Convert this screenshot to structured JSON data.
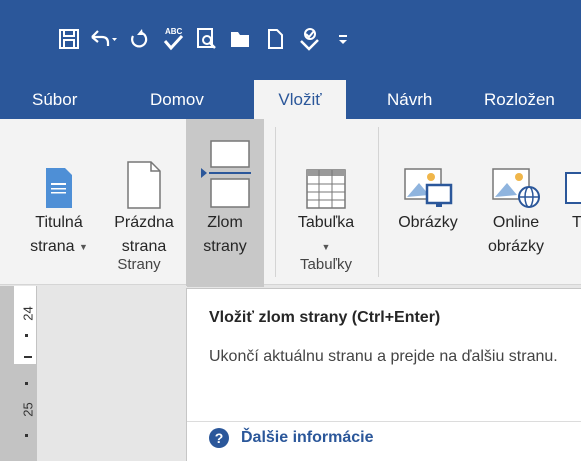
{
  "colors": {
    "brand": "#2b579a",
    "ribbon": "#f3f3f3",
    "hover": "#c8c8c8"
  },
  "qat": {
    "icons": [
      "save-icon",
      "undo-icon",
      "redo-icon",
      "spelling-icon",
      "print-preview-icon",
      "open-folder-icon",
      "new-document-icon",
      "touch-mode-icon",
      "customize-qat-icon"
    ]
  },
  "tabs": [
    {
      "label": "Súbor"
    },
    {
      "label": "Domov"
    },
    {
      "label": "Vložiť",
      "active": true
    },
    {
      "label": "Návrh"
    },
    {
      "label": "Rozložen"
    }
  ],
  "ribbon": {
    "groups": [
      {
        "label": "Strany"
      },
      {
        "label": "Tabuľky"
      }
    ],
    "buttons": {
      "cover_page": {
        "line1": "Titulná",
        "line2": "strana"
      },
      "blank_page": {
        "line1": "Prázdna",
        "line2": "strana"
      },
      "page_break": {
        "line1": "Zlom",
        "line2": "strany"
      },
      "table": {
        "line1": "Tabuľka"
      },
      "pictures": {
        "line1": "Obrázky"
      },
      "online_pictures": {
        "line1": "Online",
        "line2": "obrázky"
      },
      "cut_off": {
        "line1": "T"
      }
    }
  },
  "ruler": {
    "numbers": [
      "24",
      "25"
    ]
  },
  "tooltip": {
    "title": "Vložiť zlom strany (Ctrl+Enter)",
    "description": "Ukončí aktuálnu stranu a prejde na ďalšiu stranu.",
    "more_info": "Ďalšie informácie"
  }
}
